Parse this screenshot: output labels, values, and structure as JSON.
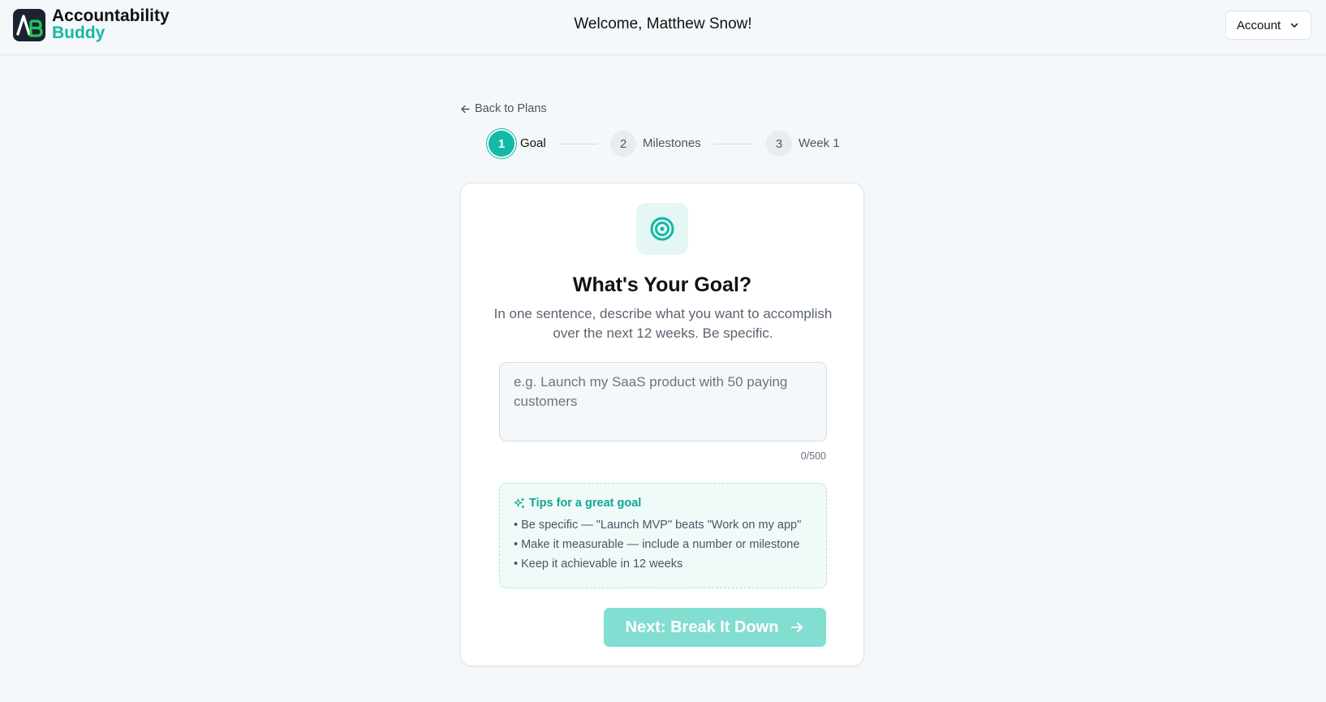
{
  "header": {
    "brand_line1": "Accountability",
    "brand_line2": "Buddy",
    "welcome": "Welcome, Matthew Snow!",
    "account_label": "Account"
  },
  "nav": {
    "back_label": "Back to Plans"
  },
  "stepper": {
    "steps": [
      {
        "number": "1",
        "label": "Goal",
        "active": true
      },
      {
        "number": "2",
        "label": "Milestones",
        "active": false
      },
      {
        "number": "3",
        "label": "Week 1",
        "active": false
      }
    ]
  },
  "card": {
    "icon": "target-icon",
    "title": "What's Your Goal?",
    "subtitle": "In one sentence, describe what you want to accomplish over the next 12 weeks. Be specific.",
    "input_value": "",
    "input_placeholder": "e.g. Launch my SaaS product with 50 paying customers",
    "char_count": "0/500",
    "tips": {
      "title": "Tips for a great goal",
      "items": [
        "• Be specific — \"Launch MVP\" beats \"Work on my app\"",
        "• Make it measurable — include a number or milestone",
        "• Keep it achievable in 12 weeks"
      ]
    },
    "next_label": "Next: Break It Down"
  },
  "colors": {
    "accent": "#14b8a6",
    "accent_light": "#e4f7f4",
    "button_disabled": "#82ded0",
    "logo_bg": "#1b2230",
    "logo_green": "#22c55e"
  }
}
